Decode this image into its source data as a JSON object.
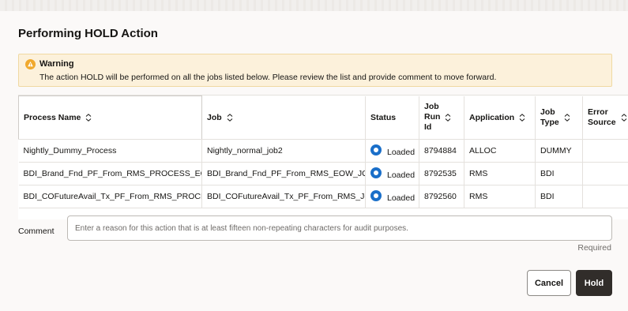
{
  "dialog": {
    "title": "Performing HOLD Action"
  },
  "warning": {
    "icon": "warning-triangle-icon",
    "title": "Warning",
    "message": "The action HOLD will be performed on all the jobs listed below. Please review the list and provide comment to move forward."
  },
  "table": {
    "headers": {
      "process_name": "Process Name",
      "job": "Job",
      "status": "Status",
      "job_run_id_1": "Job",
      "job_run_id_2": "Run",
      "job_run_id_3": "Id",
      "application": "Application",
      "job_type_1": "Job",
      "job_type_2": "Type",
      "error_source_1": "Error",
      "error_source_2": "Source"
    },
    "rows": [
      {
        "process_name": "Nightly_Dummy_Process",
        "job": "Nightly_normal_job2",
        "status": "Loaded",
        "job_run_id": "8794884",
        "application": "ALLOC",
        "job_type": "DUMMY",
        "error_source": ""
      },
      {
        "process_name": "BDI_Brand_Fnd_PF_From_RMS_PROCESS_EOW",
        "job": "BDI_Brand_Fnd_PF_From_RMS_EOW_JOB",
        "status": "Loaded",
        "job_run_id": "8792535",
        "application": "RMS",
        "job_type": "BDI",
        "error_source": ""
      },
      {
        "process_name": "BDI_COFutureAvail_Tx_PF_From_RMS_PROCESS",
        "job": "BDI_COFutureAvail_Tx_PF_From_RMS_JOB",
        "status": "Loaded",
        "job_run_id": "8792560",
        "application": "RMS",
        "job_type": "BDI",
        "error_source": ""
      }
    ]
  },
  "comment": {
    "label": "Comment",
    "value": "",
    "placeholder": "Enter a reason for this action that is at least fifteen non-repeating characters for audit purposes.",
    "required_text": "Required"
  },
  "buttons": {
    "cancel": "Cancel",
    "hold": "Hold"
  },
  "colors": {
    "warning_bg": "#fcf1db",
    "warning_icon": "#f0a92e",
    "status_loaded": "#1a6fc9",
    "primary_button": "#312d2a"
  }
}
